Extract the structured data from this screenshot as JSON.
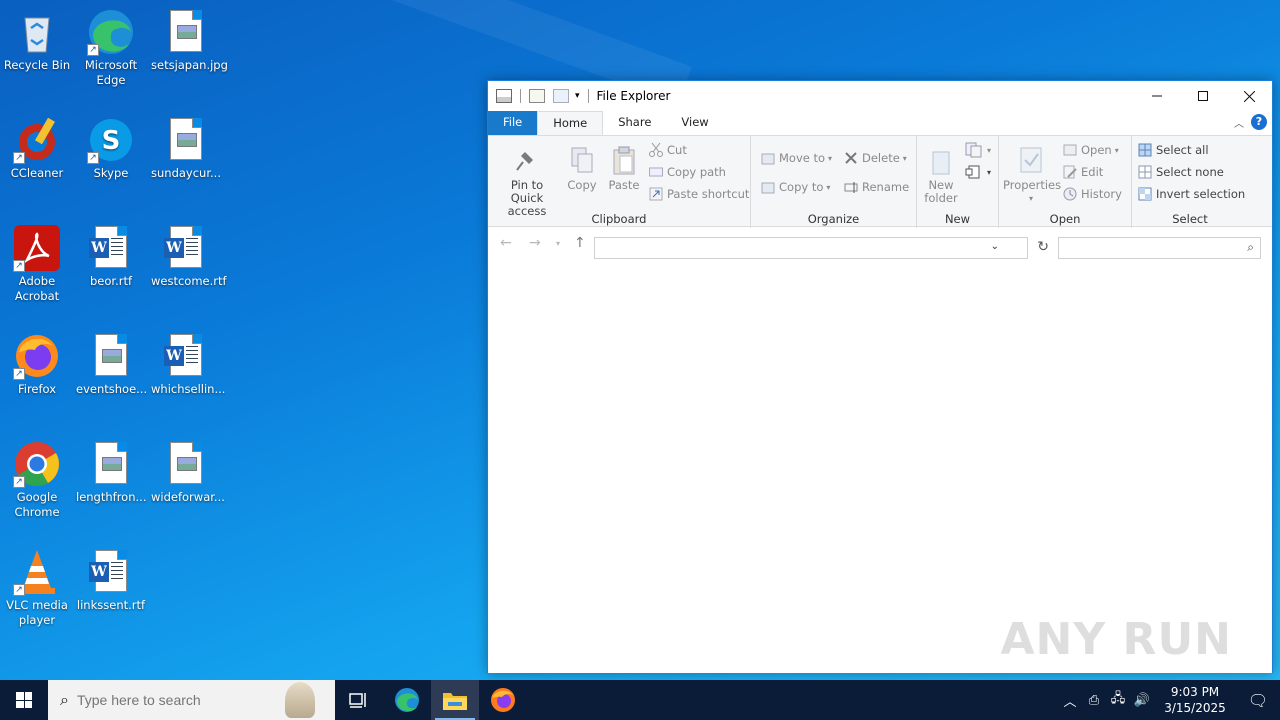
{
  "desktop": {
    "icons": [
      {
        "label": "Recycle Bin",
        "icon": "recycle-bin-icon"
      },
      {
        "label": "Microsoft Edge",
        "icon": "edge-icon"
      },
      {
        "label": "setsjapan.jpg",
        "icon": "image-file-icon"
      },
      {
        "label": "CCleaner",
        "icon": "ccleaner-icon"
      },
      {
        "label": "Skype",
        "icon": "skype-icon"
      },
      {
        "label": "sundaycur...",
        "icon": "image-file-icon"
      },
      {
        "label": "Adobe Acrobat",
        "icon": "acrobat-icon"
      },
      {
        "label": "beor.rtf",
        "icon": "word-doc-icon"
      },
      {
        "label": "westcome.rtf",
        "icon": "word-doc-icon"
      },
      {
        "label": "Firefox",
        "icon": "firefox-icon"
      },
      {
        "label": "eventshoe...",
        "icon": "image-file-icon"
      },
      {
        "label": "whichsellin...",
        "icon": "word-doc-icon"
      },
      {
        "label": "Google Chrome",
        "icon": "chrome-icon"
      },
      {
        "label": "lengthfron...",
        "icon": "image-file-icon"
      },
      {
        "label": "wideforwar...",
        "icon": "image-file-icon"
      },
      {
        "label": "VLC media player",
        "icon": "vlc-icon"
      },
      {
        "label": "linkssent.rtf",
        "icon": "word-doc-icon"
      }
    ]
  },
  "window": {
    "title": "File Explorer",
    "tabs": {
      "file": "File",
      "home": "Home",
      "share": "Share",
      "view": "View"
    },
    "help": "?",
    "ribbon": {
      "clipboard": {
        "label": "Clipboard",
        "pin": "Pin to Quick access",
        "copy": "Copy",
        "paste": "Paste",
        "cut": "Cut",
        "copy_path": "Copy path",
        "paste_shortcut": "Paste shortcut"
      },
      "organize": {
        "label": "Organize",
        "move_to": "Move to",
        "copy_to": "Copy to",
        "delete": "Delete",
        "rename": "Rename"
      },
      "new": {
        "label": "New",
        "new_folder": "New folder"
      },
      "open": {
        "label": "Open",
        "properties": "Properties",
        "open": "Open",
        "edit": "Edit",
        "history": "History"
      },
      "select": {
        "label": "Select",
        "select_all": "Select all",
        "select_none": "Select none",
        "invert": "Invert selection"
      }
    },
    "address": {
      "value": ""
    },
    "search": {
      "placeholder": ""
    },
    "watermark": "ANY RUN"
  },
  "taskbar": {
    "search_placeholder": "Type here to search",
    "clock_time": "9:03 PM",
    "clock_date": "3/15/2025",
    "pinned": [
      "task-view-icon",
      "edge-icon",
      "file-explorer-icon",
      "firefox-icon"
    ]
  }
}
